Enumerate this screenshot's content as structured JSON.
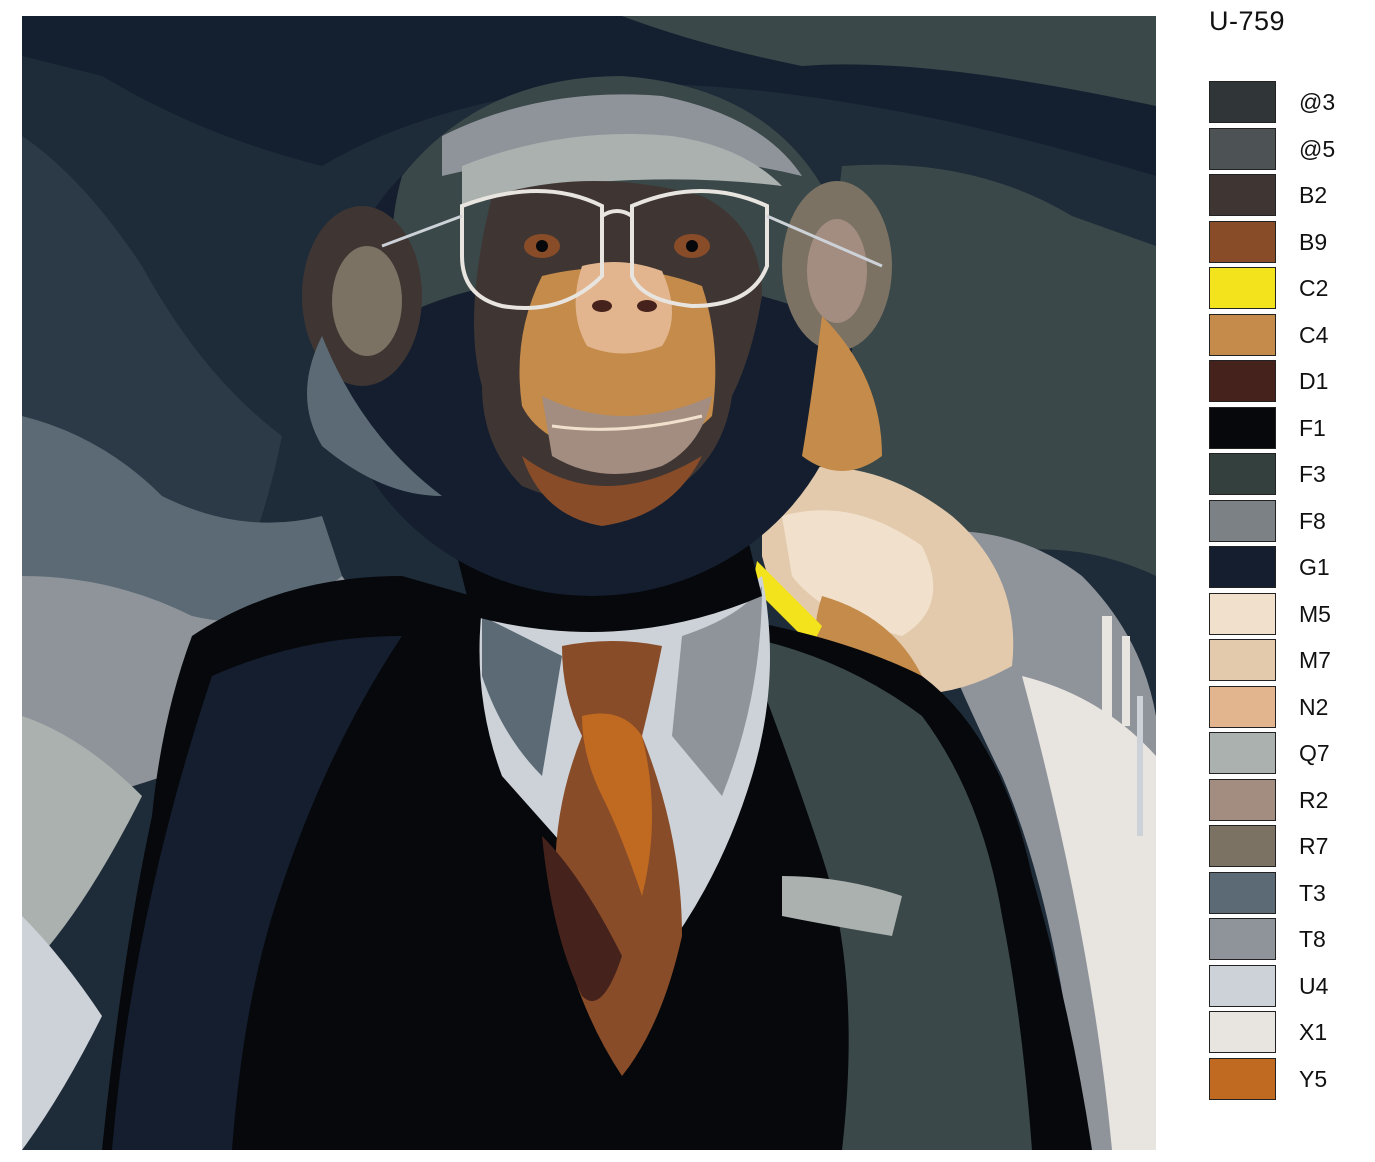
{
  "pattern_code": "U-759",
  "palette": [
    {
      "code": "@3",
      "color": "#303638"
    },
    {
      "code": "@5",
      "color": "#4d5354"
    },
    {
      "code": "B2",
      "color": "#3f3633"
    },
    {
      "code": "B9",
      "color": "#884c28"
    },
    {
      "code": "C2",
      "color": "#f2e31c"
    },
    {
      "code": "C4",
      "color": "#c48b4a"
    },
    {
      "code": "D1",
      "color": "#46221c"
    },
    {
      "code": "F1",
      "color": "#06080b"
    },
    {
      "code": "F3",
      "color": "#33403e"
    },
    {
      "code": "F8",
      "color": "#7b8185"
    },
    {
      "code": "G1",
      "color": "#141e2e"
    },
    {
      "code": "M5",
      "color": "#f1e1cc"
    },
    {
      "code": "M7",
      "color": "#e3caad"
    },
    {
      "code": "N2",
      "color": "#e2b58e"
    },
    {
      "code": "Q7",
      "color": "#abb1ae"
    },
    {
      "code": "R2",
      "color": "#a38c80"
    },
    {
      "code": "R7",
      "color": "#7b7264"
    },
    {
      "code": "T3",
      "color": "#5b6a74"
    },
    {
      "code": "T8",
      "color": "#8f949b"
    },
    {
      "code": "U4",
      "color": "#cdd2d9"
    },
    {
      "code": "X1",
      "color": "#e8e4df"
    },
    {
      "code": "Y5",
      "color": "#c06a21"
    }
  ]
}
